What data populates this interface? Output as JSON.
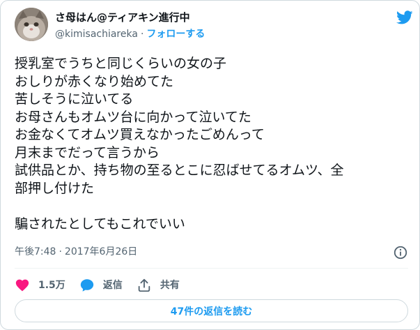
{
  "author": {
    "display_name": "さ母はん@ティアキン進行中",
    "handle": "@kimisachiareka",
    "separator": "·",
    "follow_label": "フォローする"
  },
  "tweet": {
    "lines": [
      "授乳室でうちと同じくらいの女の子",
      "おしりが赤くなり始めてた",
      "苦しそうに泣いてる",
      "お母さんもオムツ台に向かって泣いてた",
      "お金なくてオムツ買えなかったごめんって",
      "月末までだって言うから",
      "試供品とか、持ち物の至るとこに忍ばせてるオムツ、全",
      "部押し付けた",
      "",
      "騙されたとしてもこれでいい"
    ]
  },
  "meta": {
    "time": "午後7:48",
    "separator": "·",
    "date": "2017年6月26日"
  },
  "actions": {
    "like_count": "1.5万",
    "reply_label": "返信",
    "share_label": "共有"
  },
  "read_replies_label": "47件の返信を読む",
  "colors": {
    "accent": "#1d9bf0",
    "like": "#f91880",
    "text": "#0f1419",
    "muted": "#536471",
    "border": "#cfd9de"
  },
  "icons": {
    "brand": "twitter-bird-icon",
    "info": "info-icon",
    "like": "heart-icon",
    "reply": "speech-bubble-icon",
    "share": "share-arrow-icon"
  }
}
